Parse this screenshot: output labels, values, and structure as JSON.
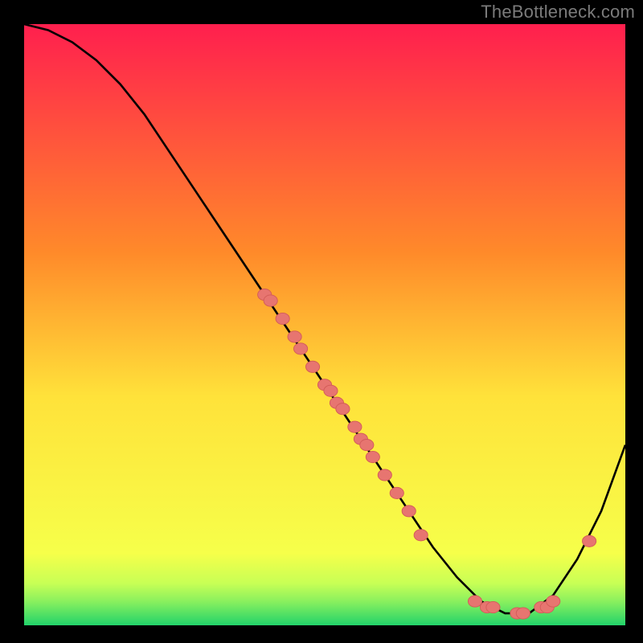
{
  "watermark": "TheBottleneck.com",
  "colors": {
    "bg": "#000000",
    "watermark": "#7b7b7b",
    "curve": "#000000",
    "marker_fill": "#e77570",
    "marker_stroke": "#d25b58"
  },
  "chart_data": {
    "type": "line",
    "title": "",
    "xlabel": "",
    "ylabel": "",
    "xlim": [
      0,
      100
    ],
    "ylim": [
      0,
      100
    ],
    "grid": false,
    "legend": false,
    "background_gradient": {
      "top_color": "#ff1f4e",
      "mid_color": "#ffe23a",
      "bottom_color": "#22d36a"
    },
    "series": [
      {
        "name": "bottleneck-curve",
        "x": [
          0,
          4,
          8,
          12,
          16,
          20,
          24,
          28,
          32,
          36,
          40,
          44,
          48,
          52,
          56,
          60,
          64,
          68,
          72,
          76,
          80,
          84,
          88,
          92,
          96,
          100
        ],
        "y": [
          100,
          99,
          97,
          94,
          90,
          85,
          79,
          73,
          67,
          61,
          55,
          49,
          43,
          37,
          31,
          25,
          19,
          13,
          8,
          4,
          2,
          2,
          5,
          11,
          19,
          30
        ]
      }
    ],
    "markers": {
      "name": "highlight-points",
      "x": [
        40,
        41,
        43,
        45,
        46,
        48,
        50,
        51,
        52,
        53,
        55,
        56,
        57,
        58,
        60,
        62,
        64,
        66,
        75,
        77,
        78,
        82,
        83,
        86,
        87,
        88,
        94
      ],
      "y": [
        55,
        54,
        51,
        48,
        46,
        43,
        40,
        39,
        37,
        36,
        33,
        31,
        30,
        28,
        25,
        22,
        19,
        15,
        4,
        3,
        3,
        2,
        2,
        3,
        3,
        4,
        14
      ]
    }
  }
}
